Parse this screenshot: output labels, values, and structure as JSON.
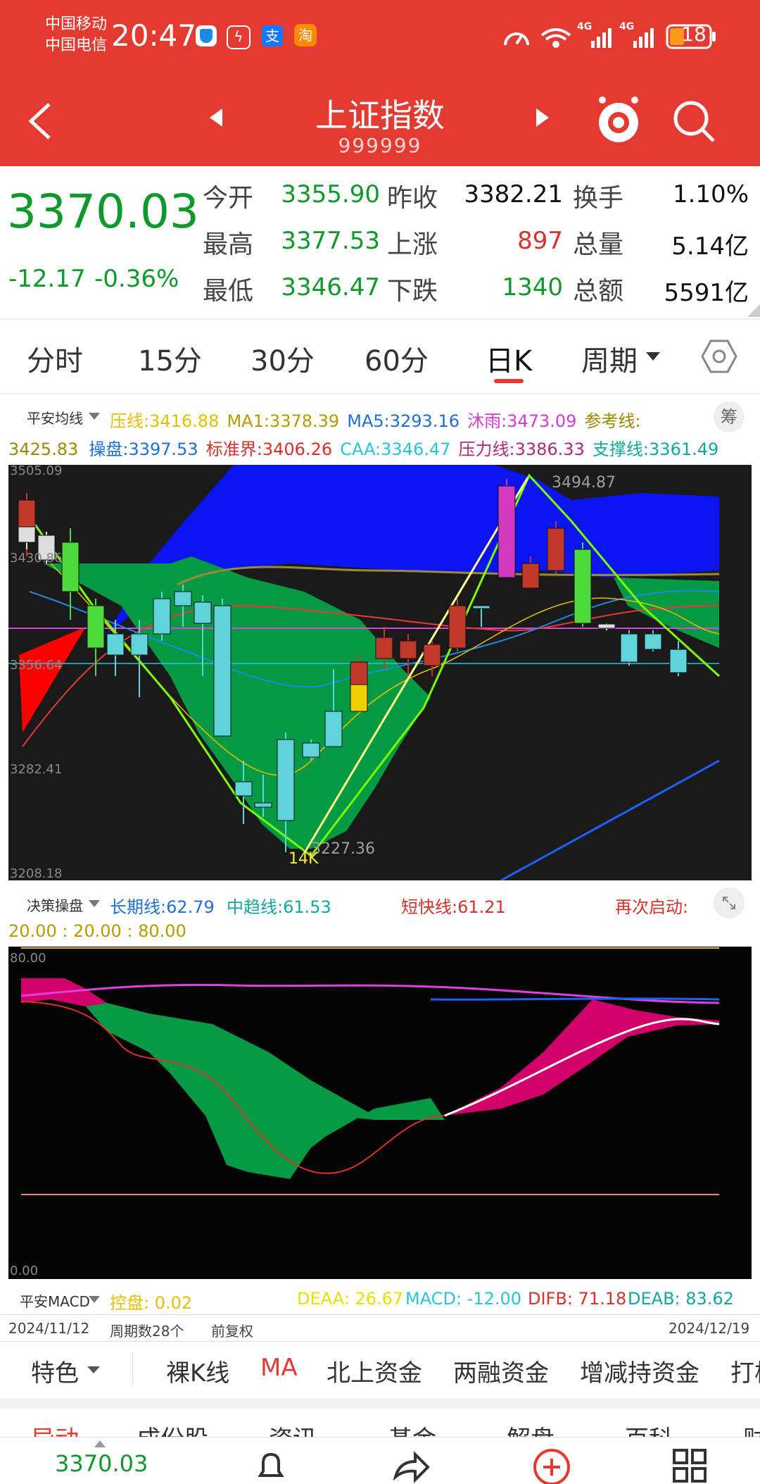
{
  "status_bar": {
    "carrier1": "中国移动",
    "carrier2": "中国电信",
    "time": "20:47",
    "battery": "18",
    "net1": "4G",
    "net2": "4G"
  },
  "header": {
    "title": "上证指数",
    "code": "999999"
  },
  "quote": {
    "price": "3370.03",
    "change": "-12.17",
    "change_pct": "-0.36%",
    "rows": [
      {
        "l1": "今开",
        "v1": "3355.90",
        "l2": "昨收",
        "v2": "3382.21",
        "l3": "换手",
        "v3": "1.10%"
      },
      {
        "l1": "最高",
        "v1": "3377.53",
        "l2": "上涨",
        "v2": "897",
        "l3": "总量",
        "v3": "5.14亿"
      },
      {
        "l1": "最低",
        "v1": "3346.47",
        "l2": "下跌",
        "v2": "1340",
        "l3": "总额",
        "v3": "5591亿"
      }
    ]
  },
  "tabs": [
    "分时",
    "15分",
    "30分",
    "60分",
    "日K",
    "周期"
  ],
  "active_tab": "日K",
  "ma_panel": {
    "name": "平安均线",
    "chip": "筹",
    "items": [
      {
        "label": "压线:",
        "value": "3416.88",
        "color": "#E6C000"
      },
      {
        "label": "MA1:",
        "value": "3378.39",
        "color": "#B59B00"
      },
      {
        "label": "MA5:",
        "value": "3293.16",
        "color": "#1E6FD9"
      },
      {
        "label": "沐雨:",
        "value": "3473.09",
        "color": "#D23BD6"
      },
      {
        "label": "参考线:",
        "value": "",
        "color": "#9A8A00"
      },
      {
        "label": "",
        "value": "3425.83",
        "color": "#9A8A00"
      },
      {
        "label": "操盘:",
        "value": "3397.53",
        "color": "#1E6FD9"
      },
      {
        "label": "标准界:",
        "value": "3406.26",
        "color": "#D8312B"
      },
      {
        "label": "CAA:",
        "value": "3346.47",
        "color": "#26C6DA"
      },
      {
        "label": "压力线:",
        "value": "3386.33",
        "color": "#B4287A"
      },
      {
        "label": "支撑线:",
        "value": "3361.49",
        "color": "#13A89E"
      }
    ]
  },
  "kline": {
    "y_labels": [
      "3505.09",
      "3430.86",
      "3356.64",
      "3282.41",
      "3208.18"
    ],
    "high_label": "3494.87",
    "low_label": "3227.36",
    "marker": "14K"
  },
  "decision_panel": {
    "name": "决策操盘",
    "long_line": "长期线:62.79",
    "mid_line": "中趋线:61.53",
    "short_line": "短快线:61.21",
    "restart": "再次启动:",
    "levels": "20.00 : 20.00 : 80.00",
    "y_top": "80.00",
    "y_bottom": "0.00"
  },
  "macd_panel": {
    "name": "平安MACD",
    "kongpan": "控盘: 0.02",
    "deaa": "DEAA: 26.67",
    "macd": "MACD: -12.00",
    "difb": "DIFB: 71.18",
    "deab": "DEAB: 83.62"
  },
  "period_bar": {
    "start": "2024/11/12",
    "count": "周期数28个",
    "adjust": "前复权",
    "end": "2024/12/19"
  },
  "feature_tabs": [
    "特色",
    "裸K线",
    "MA",
    "北上资金",
    "两融资金",
    "增减持资金",
    "打板"
  ],
  "partial_tabs": [
    "异动",
    "成份股",
    "资讯",
    "基金",
    "解盘",
    "百科",
    "财"
  ],
  "bottom_nav": {
    "price": "3370.03"
  },
  "colors": {
    "header_red": "#E33B32",
    "up_red": "#D8312B",
    "down_green": "#0E9A2A"
  }
}
